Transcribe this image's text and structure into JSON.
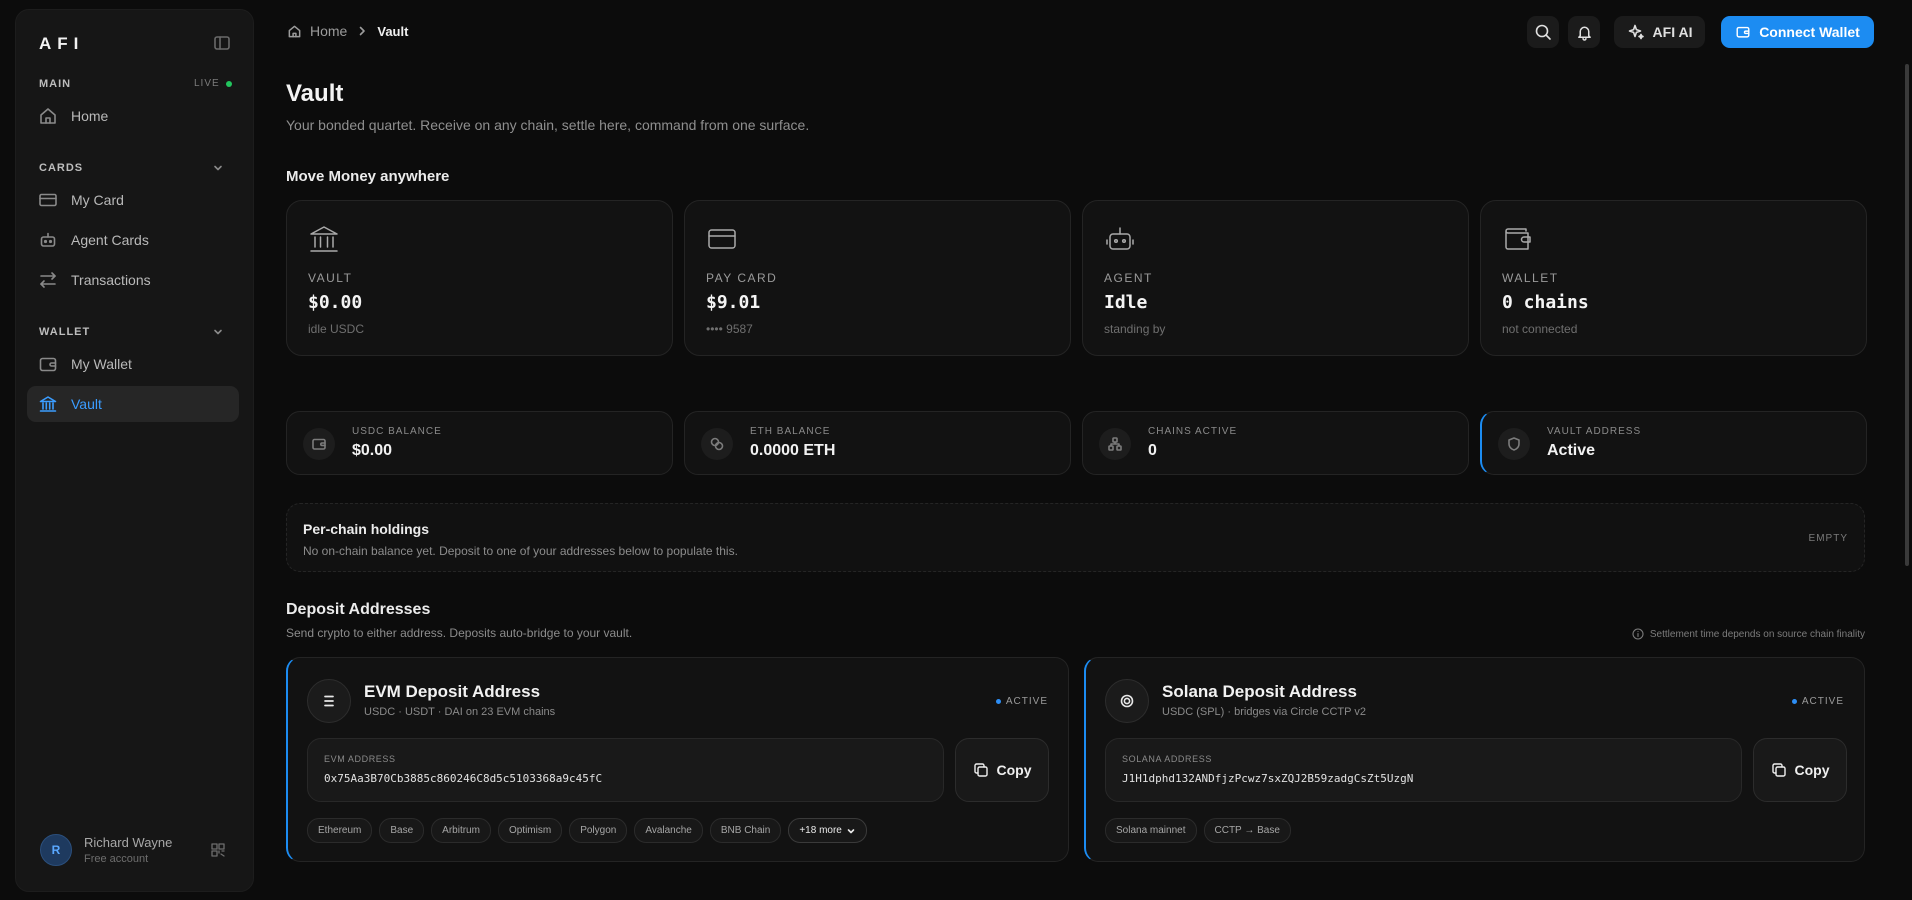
{
  "sidebar": {
    "logo": "AFI",
    "sections": {
      "main": "MAIN",
      "live": "LIVE",
      "cards": "CARDS",
      "wallet": "WALLET"
    },
    "items": {
      "home": "Home",
      "my_card": "My Card",
      "agent_cards": "Agent Cards",
      "transactions": "Transactions",
      "my_wallet": "My Wallet",
      "vault": "Vault"
    },
    "user": {
      "initial": "R",
      "name": "Richard Wayne",
      "plan": "Free account"
    }
  },
  "topbar": {
    "breadcrumb_home": "Home",
    "breadcrumb_current": "Vault",
    "ai_label": "AFI AI",
    "connect_label": "Connect Wallet"
  },
  "header": {
    "title": "Vault",
    "subtitle": "Your bonded quartet. Receive on any chain, settle here, command from one surface."
  },
  "move_money": {
    "title": "Move Money anywhere",
    "cards": [
      {
        "label": "VAULT",
        "value": "$0.00",
        "sub": "idle USDC"
      },
      {
        "label": "PAY CARD",
        "value": "$9.01",
        "sub": "•••• 9587"
      },
      {
        "label": "AGENT",
        "value": "Idle",
        "sub": "standing by"
      },
      {
        "label": "WALLET",
        "value": "0 chains",
        "sub": "not connected"
      }
    ]
  },
  "stats": [
    {
      "label": "USDC BALANCE",
      "value": "$0.00"
    },
    {
      "label": "ETH BALANCE",
      "value": "0.0000 ETH"
    },
    {
      "label": "CHAINS ACTIVE",
      "value": "0"
    },
    {
      "label": "VAULT ADDRESS",
      "value": "Active"
    }
  ],
  "holdings": {
    "title": "Per-chain holdings",
    "desc": "No on-chain balance yet. Deposit to one of your addresses below to populate this.",
    "status": "EMPTY"
  },
  "deposit": {
    "title": "Deposit Addresses",
    "subtitle": "Send crypto to either address. Deposits auto-bridge to your vault.",
    "note": "Settlement time depends on source chain finality",
    "evm": {
      "title": "EVM Deposit Address",
      "sub": "USDC · USDT · DAI on 23 EVM chains",
      "status": "ACTIVE",
      "addr_label": "EVM ADDRESS",
      "address": "0x75Aa3B70Cb3885c860246C8d5c5103368a9c45fC",
      "copy": "Copy",
      "chips": [
        "Ethereum",
        "Base",
        "Arbitrum",
        "Optimism",
        "Polygon",
        "Avalanche",
        "BNB Chain"
      ],
      "more": "+18 more"
    },
    "solana": {
      "title": "Solana Deposit Address",
      "sub": "USDC (SPL) · bridges via Circle CCTP v2",
      "status": "ACTIVE",
      "addr_label": "SOLANA ADDRESS",
      "address": "J1H1dphd132ANDfjzPcwz7sxZQJ2B59zadgCsZt5UzgN",
      "copy": "Copy",
      "chips": [
        "Solana mainnet",
        "CCTP → Base"
      ]
    }
  },
  "colors": {
    "accent": "#1c8cf2",
    "live_dot": "#22c55e",
    "background": "#0c0c0c"
  }
}
